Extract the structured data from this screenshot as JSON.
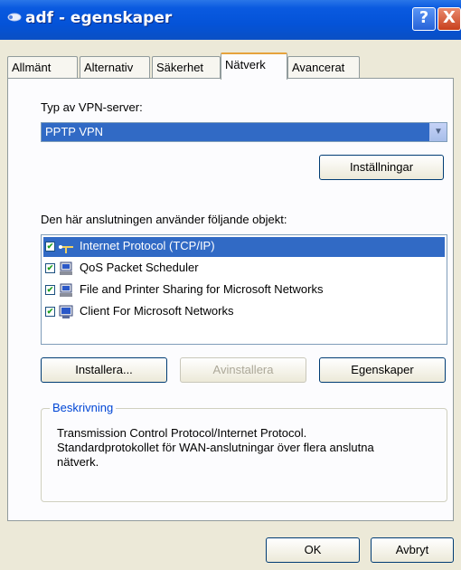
{
  "window": {
    "title": "adf - egenskaper",
    "help_glyph": "?",
    "close_glyph": "X"
  },
  "tabs": [
    {
      "label": "Allmänt"
    },
    {
      "label": "Alternativ"
    },
    {
      "label": "Säkerhet"
    },
    {
      "label": "Nätverk",
      "active": true
    },
    {
      "label": "Avancerat"
    }
  ],
  "vpn": {
    "label": "Typ av VPN-server:",
    "selected": "PPTP VPN",
    "settings_button": "Inställningar"
  },
  "components": {
    "label": "Den här anslutningen använder följande objekt:",
    "items": [
      {
        "label": "Internet Protocol (TCP/IP)",
        "checked": true,
        "selected": true,
        "icon": "network-protocol-icon"
      },
      {
        "label": "QoS Packet Scheduler",
        "checked": true,
        "selected": false,
        "icon": "network-service-icon"
      },
      {
        "label": "File and Printer Sharing for Microsoft Networks",
        "checked": true,
        "selected": false,
        "icon": "network-service-icon"
      },
      {
        "label": "Client For Microsoft Networks",
        "checked": true,
        "selected": false,
        "icon": "network-client-icon"
      }
    ]
  },
  "actions": {
    "install": "Installera...",
    "uninstall": "Avinstallera",
    "properties": "Egenskaper"
  },
  "description": {
    "title": "Beskrivning",
    "text_line1": "Transmission Control Protocol/Internet Protocol.",
    "text_line2": "Standardprotokollet för WAN-anslutningar över flera anslutna",
    "text_line3": "nätverk."
  },
  "footer": {
    "ok": "OK",
    "cancel": "Avbryt"
  },
  "colors": {
    "titlebar": "#0453d8",
    "selection": "#316ac5",
    "tab_highlight": "#e6a33c",
    "dialog_bg": "#ece9d8"
  }
}
